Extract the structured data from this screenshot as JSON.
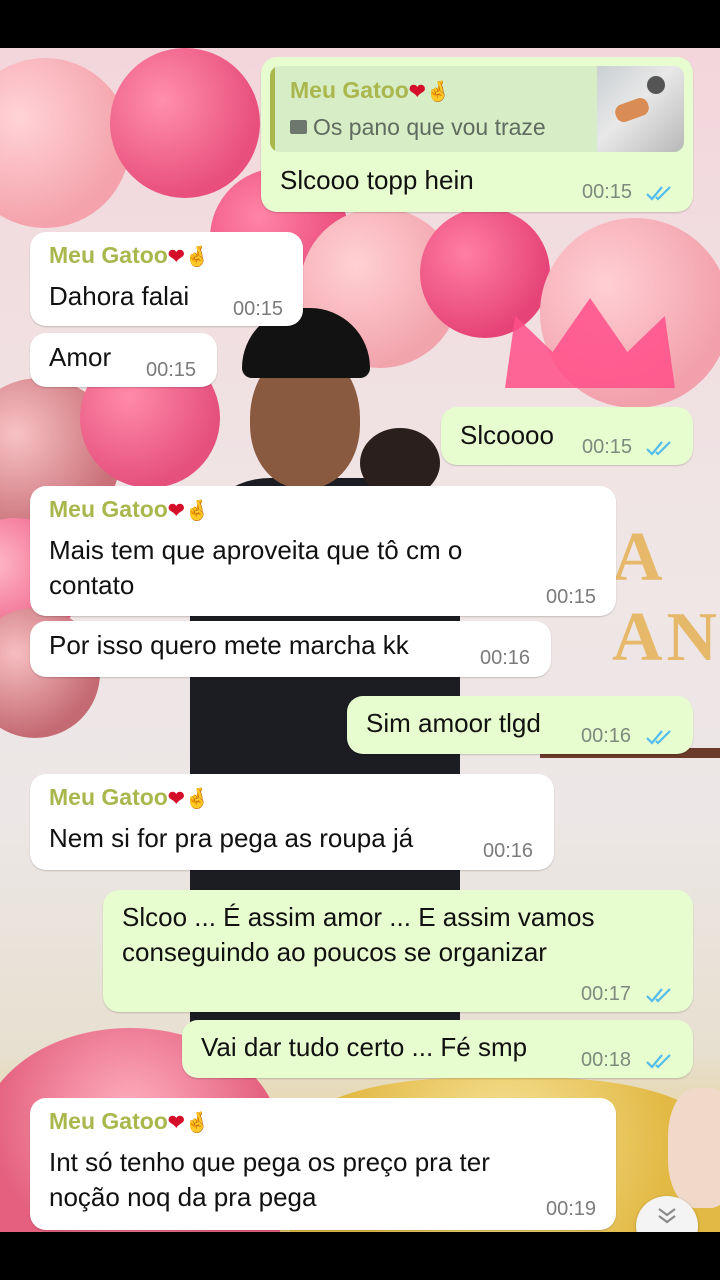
{
  "contact": {
    "name": "Meu Gatoo",
    "heart": "❤",
    "hand": "🤞"
  },
  "messages": [
    {
      "dir": "out",
      "quote": {
        "name": "Meu Gatoo",
        "text": "Os pano que vou traze",
        "icon": "photo-icon"
      },
      "text": "Slcooo topp hein",
      "time": "00:15",
      "read": true
    },
    {
      "dir": "in",
      "sender": true,
      "text": "Dahora falai",
      "time": "00:15"
    },
    {
      "dir": "in",
      "text": "Amor",
      "time": "00:15"
    },
    {
      "dir": "out",
      "text": "Slcoooo",
      "time": "00:15",
      "read": true
    },
    {
      "dir": "in",
      "sender": true,
      "lines": [
        "Mais tem que aproveita que tô cm o",
        "contato"
      ],
      "time": "00:15"
    },
    {
      "dir": "in",
      "text": "Por isso quero mete marcha kk",
      "time": "00:16"
    },
    {
      "dir": "out",
      "text": "Sim amoor tlgd",
      "time": "00:16",
      "read": true
    },
    {
      "dir": "in",
      "sender": true,
      "text": "Nem si for pra pega as roupa já",
      "time": "00:16"
    },
    {
      "dir": "out",
      "lines": [
        "Slcoo ... É assim amor ... E assim vamos",
        "conseguindo ao poucos se organizar"
      ],
      "time": "00:17",
      "read": true
    },
    {
      "dir": "out",
      "text": "Vai dar tudo certo ... Fé smp",
      "time": "00:18",
      "read": true
    },
    {
      "dir": "in",
      "sender": true,
      "lines": [
        "Int só tenho que pega os preço pra ter",
        "noção noq da pra pega"
      ],
      "time": "00:19"
    }
  ],
  "wallpaper_text": "A\nANNA",
  "colors": {
    "incoming": "#ffffff",
    "outgoing": "#e7fccf",
    "sender": "#a9b74d",
    "read_ticks": "#53bdeb"
  },
  "scroll_button_icon": "double-chevron-down-icon"
}
